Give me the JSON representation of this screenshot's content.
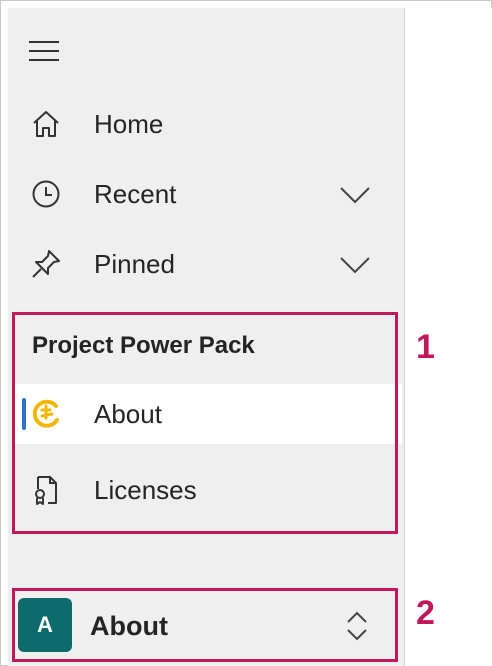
{
  "nav": {
    "items": [
      {
        "label": "Home",
        "icon": "home-icon"
      },
      {
        "label": "Recent",
        "icon": "clock-icon",
        "expandable": true
      },
      {
        "label": "Pinned",
        "icon": "pin-icon",
        "expandable": true
      }
    ]
  },
  "section": {
    "title": "Project Power Pack",
    "items": [
      {
        "label": "About",
        "icon": "power-pack-logo-icon",
        "selected": true
      },
      {
        "label": "Licenses",
        "icon": "license-document-icon"
      }
    ]
  },
  "footer": {
    "avatar_letter": "A",
    "label": "About"
  },
  "annotations": [
    "1",
    "2"
  ],
  "colors": {
    "sidebar_bg": "#efefef",
    "selected_bg": "#ffffff",
    "selection_indicator": "#2f6fd6",
    "annotation": "#c2185b",
    "avatar_bg": "#0e6b6b",
    "logo_yellow": "#f2b705"
  }
}
